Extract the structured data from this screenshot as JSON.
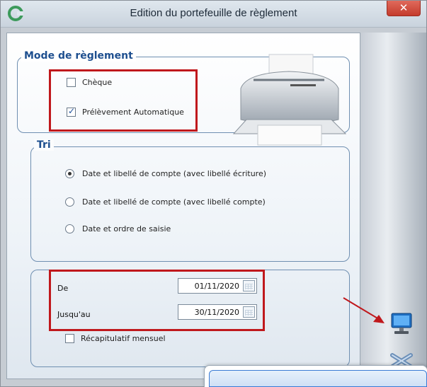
{
  "window": {
    "title": "Edition du portefeuille de règlement",
    "close_label": "✕"
  },
  "payment_mode": {
    "legend": "Mode de règlement",
    "options": [
      {
        "label": "Chèque",
        "checked": false
      },
      {
        "label": "Prélèvement Automatique",
        "checked": true
      }
    ]
  },
  "sort": {
    "legend": "Tri",
    "options": [
      {
        "label": "Date et libellé de compte (avec libellé écriture)",
        "checked": true
      },
      {
        "label": "Date et libellé de compte (avec libellé compte)",
        "checked": false
      },
      {
        "label": "Date et ordre de saisie",
        "checked": false
      }
    ]
  },
  "period": {
    "from_label": "De",
    "from_value": "01/11/2020",
    "to_label": "Jusqu'au",
    "to_value": "30/11/2020",
    "monthly_summary_label": "Récapitulatif mensuel",
    "monthly_summary_checked": false
  },
  "colors": {
    "highlight_red": "#c0181c",
    "group_border": "#6f8fb1",
    "legend_text": "#1e4f8f"
  },
  "icons": [
    "app-logo-icon",
    "printer-icon",
    "screen-preview-icon",
    "cancel-icon",
    "calendar-icon",
    "arrow-icon"
  ]
}
